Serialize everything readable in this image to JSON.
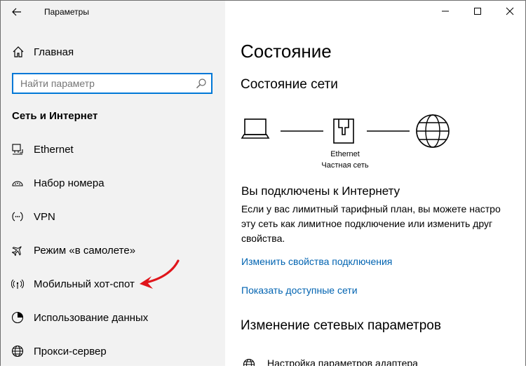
{
  "window": {
    "title": "Параметры",
    "minimize_icon": "minimize-icon",
    "maximize_icon": "maximize-icon",
    "close_icon": "close-icon"
  },
  "sidebar": {
    "home_label": "Главная",
    "search_placeholder": "Найти параметр",
    "section_title": "Сеть и Интернет",
    "items": [
      {
        "label": "Ethernet",
        "icon": "ethernet-icon"
      },
      {
        "label": "Набор номера",
        "icon": "dial-up-icon"
      },
      {
        "label": "VPN",
        "icon": "vpn-icon"
      },
      {
        "label": "Режим «в самолете»",
        "icon": "airplane-icon"
      },
      {
        "label": "Мобильный хот-спот",
        "icon": "hotspot-icon"
      },
      {
        "label": "Использование данных",
        "icon": "data-usage-icon"
      },
      {
        "label": "Прокси-сервер",
        "icon": "globe-icon"
      }
    ]
  },
  "main": {
    "title": "Состояние",
    "network_status_title": "Состояние сети",
    "diagram": {
      "adapter_name": "Ethernet",
      "network_type": "Частная сеть"
    },
    "connected_heading": "Вы подключены к Интернету",
    "description_lines": [
      "Если у вас лимитный тарифный план, вы можете настро",
      "эту сеть как лимитное подключение или изменить друг",
      "свойства."
    ],
    "link_change_properties": "Изменить свойства подключения",
    "link_show_networks": "Показать доступные сети",
    "change_settings_title": "Изменение сетевых параметров",
    "adapter_settings_label": "Настройка параметров адаптера"
  },
  "colors": {
    "accent": "#0078d7",
    "link": "#0063b1",
    "sidebar_bg": "#f2f2f2",
    "annotation_arrow": "#e0151b"
  }
}
